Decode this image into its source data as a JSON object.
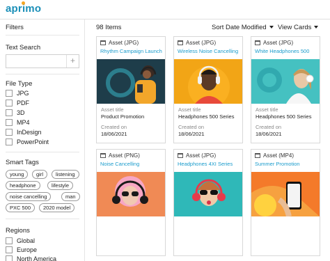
{
  "brand": {
    "logo_text": "aprimo",
    "colors": {
      "accent": "#1b9ccc",
      "logo_dot": "#f5a623"
    }
  },
  "sidebar": {
    "filters_label": "Filters",
    "text_search": {
      "label": "Text Search",
      "value": "",
      "placeholder": "",
      "add_icon": "plus-icon"
    },
    "file_type": {
      "label": "File Type",
      "options": [
        "JPG",
        "PDF",
        "3D",
        "MP4",
        "InDesign",
        "PowerPoint"
      ]
    },
    "smart_tags": {
      "label": "Smart Tags",
      "tags": [
        "young",
        "girl",
        "listening",
        "headphone",
        "lifestyle",
        "noise cancelling",
        "man",
        "PXC 500",
        "2020 model"
      ]
    },
    "regions": {
      "label": "Regions",
      "options": [
        "Global",
        "Europe",
        "North America"
      ]
    }
  },
  "main": {
    "item_count": "98 Items",
    "sort_label": "Sort Date Modified",
    "view_label": "View Cards",
    "cards": [
      {
        "type": "Asset (JPG)",
        "name": "Rhythm Campaign Launch",
        "title_label": "Asset title",
        "title": "Product Promotion",
        "created_label": "Created on",
        "created": "18/06/2021",
        "bg": "#1f3b48"
      },
      {
        "type": "Asset (JPG)",
        "name": "Wireless Noise Cancelling",
        "title_label": "Asset title",
        "title": "Headphones 500 Series",
        "created_label": "Created on",
        "created": "18/06/2021",
        "bg": "#f2a516"
      },
      {
        "type": "Asset (JPG)",
        "name": "White Headphones 500",
        "title_label": "Asset title",
        "title": "Headphones 500 Series",
        "created_label": "Created on",
        "created": "18/06/2021",
        "bg": "#3fbdbd"
      },
      {
        "type": "Asset (PNG)",
        "name": "Noise Cancelling",
        "title_label": "",
        "title": "",
        "created_label": "",
        "created": "",
        "bg": "#f08a55"
      },
      {
        "type": "Asset (JPG)",
        "name": "Headphones 4XI Series",
        "title_label": "",
        "title": "",
        "created_label": "",
        "created": "",
        "bg": "#2fb8b8"
      },
      {
        "type": "Asset (MP4)",
        "name": "Summer Promotion",
        "title_label": "",
        "title": "",
        "created_label": "",
        "created": "",
        "bg": "#f47a2a"
      }
    ]
  }
}
